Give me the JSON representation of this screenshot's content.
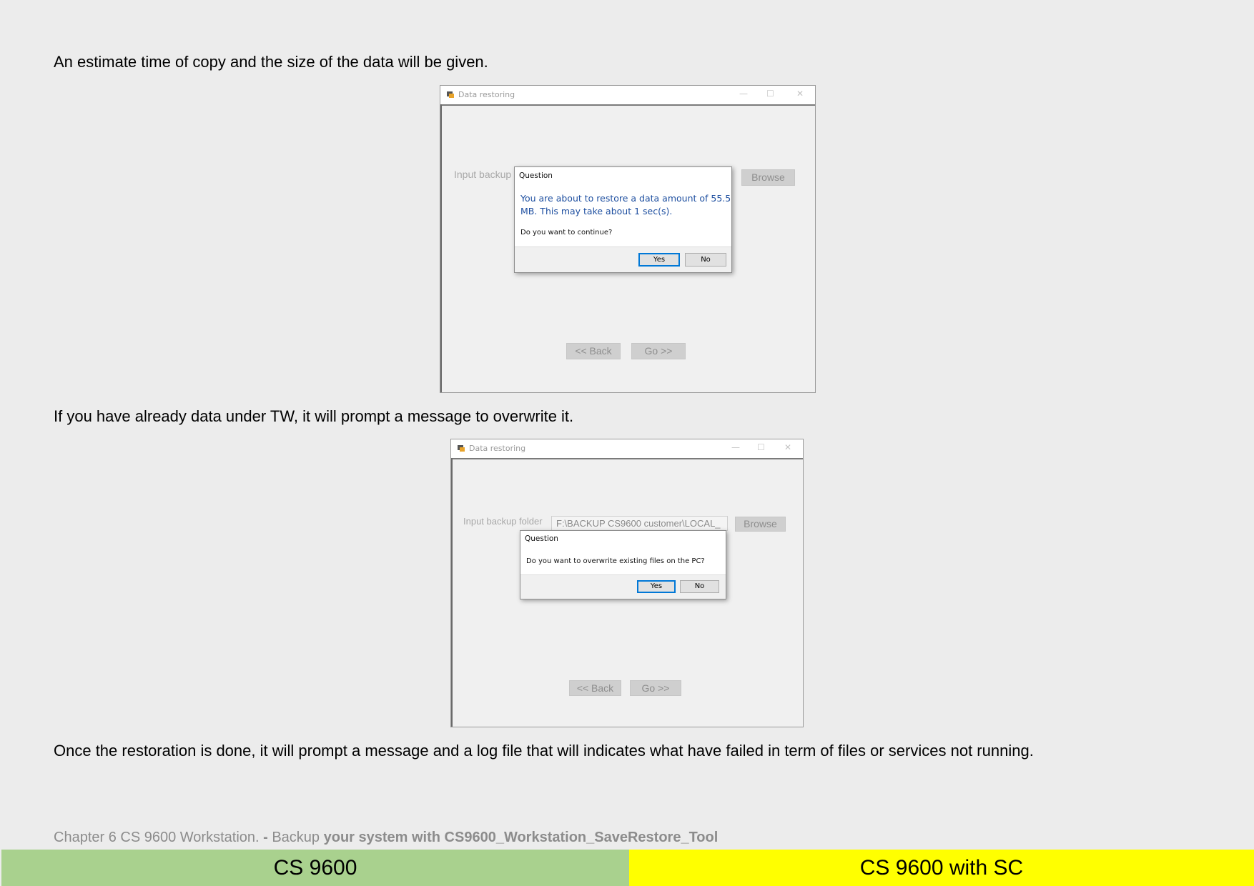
{
  "paragraphs": {
    "p1": "An estimate time of copy and the size of the data will be given.",
    "p2": "If you have already data under TW, it will prompt a message to overwrite it.",
    "p3": "Once the restoration is done, it will prompt a message and a log file that will indicates what have failed in term of files or services not running."
  },
  "screenshot1": {
    "window_title": "Data restoring",
    "folder_label": "Input backup",
    "browse": "Browse",
    "back": "<< Back",
    "go": "Go >>",
    "dialog": {
      "title": "Question",
      "message_line1": "You are about to restore a data amount of 55.5",
      "message_line2": "MB. This may take about 1 sec(s).",
      "question": "Do you want to continue?",
      "yes": "Yes",
      "no": "No"
    }
  },
  "screenshot2": {
    "window_title": "Data restoring",
    "folder_label": "Input backup folder",
    "folder_value": "F:\\BACKUP CS9600 customer\\LOCAL_",
    "browse": "Browse",
    "back": "<< Back",
    "go": "Go >>",
    "dialog": {
      "title": "Question",
      "question": "Do you want to overwrite existing files on the PC?",
      "yes": "Yes",
      "no": "No"
    }
  },
  "footer": {
    "chapter": "Chapter 6 CS 9600 Workstation.",
    "dash": " - ",
    "backup": "Backup ",
    "rest": "your system with CS9600_Workstation_SaveRestore_Tool"
  },
  "bands": {
    "left": "CS 9600",
    "right": "CS 9600 with SC",
    "left_color": "#a9d18e",
    "right_color": "#ffff00"
  }
}
